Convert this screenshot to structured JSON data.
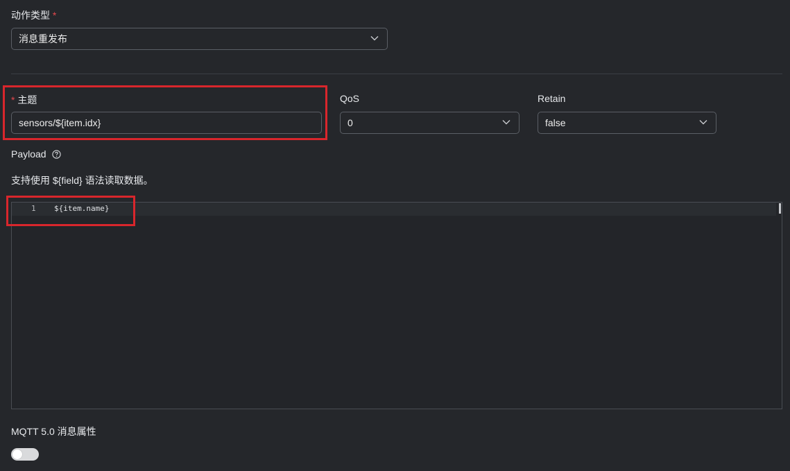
{
  "action": {
    "label": "动作类型",
    "required_mark": "*",
    "value": "消息重发布"
  },
  "topic": {
    "required_mark": "*",
    "label": "主题",
    "value": "sensors/${item.idx}"
  },
  "qos": {
    "label": "QoS",
    "value": "0"
  },
  "retain": {
    "label": "Retain",
    "value": "false"
  },
  "payload": {
    "label": "Payload",
    "help_icon": "question-circle-icon",
    "description": "支持使用 ${field} 语法读取数据。",
    "editor": {
      "line_number": "1",
      "code": "${item.name}"
    }
  },
  "mqtt5": {
    "label": "MQTT 5.0 消息属性",
    "toggle_on": false
  },
  "colors": {
    "background": "#25272b",
    "highlight": "#d9262c",
    "required": "#e5484d"
  }
}
